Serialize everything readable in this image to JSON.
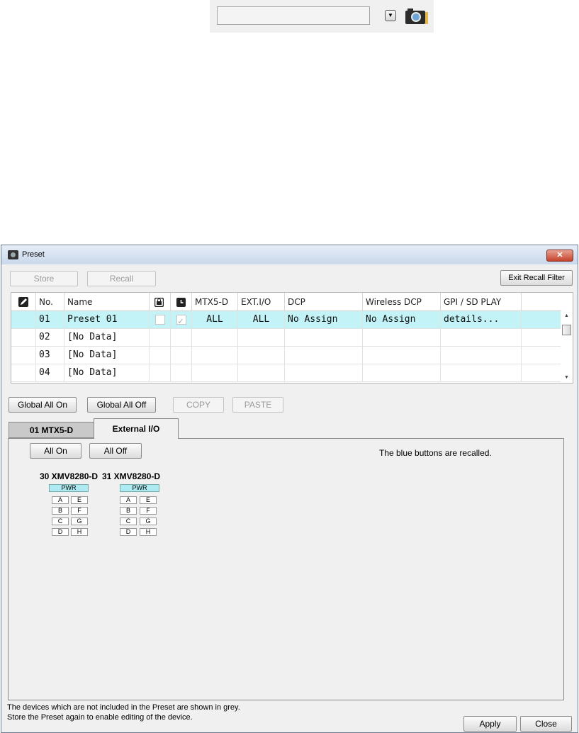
{
  "top_toolbar": {
    "dropdown_icon": "chevron-down-icon",
    "camera_icon": "camera-icon"
  },
  "window": {
    "title": "Preset",
    "close_glyph": "✕"
  },
  "toolbar": {
    "store": "Store",
    "recall": "Recall",
    "exit_recall_filter": "Exit Recall Filter"
  },
  "table": {
    "headers": {
      "edit_icon": "edit-icon",
      "no": "No.",
      "name": "Name",
      "protect_icon": "lock-icon",
      "scheduler_icon": "clock-icon",
      "mtx5d": "MTX5-D",
      "extio": "EXT.I/O",
      "dcp": "DCP",
      "wireless_dcp": "Wireless DCP",
      "gpi": "GPI / SD PLAY"
    },
    "rows": [
      {
        "no": "01",
        "name": "Preset 01",
        "protect": false,
        "scheduler": true,
        "mtx5d": "ALL",
        "extio": "ALL",
        "dcp": "No Assign",
        "wireless_dcp": "No Assign",
        "gpi": "details..."
      },
      {
        "no": "02",
        "name": "[No Data]",
        "mtx5d": "",
        "extio": "",
        "dcp": "",
        "wireless_dcp": "",
        "gpi": ""
      },
      {
        "no": "03",
        "name": "[No Data]",
        "mtx5d": "",
        "extio": "",
        "dcp": "",
        "wireless_dcp": "",
        "gpi": ""
      },
      {
        "no": "04",
        "name": "[No Data]",
        "mtx5d": "",
        "extio": "",
        "dcp": "",
        "wireless_dcp": "",
        "gpi": ""
      }
    ]
  },
  "actions": {
    "global_all_on": "Global All On",
    "global_all_off": "Global All Off",
    "copy": "COPY",
    "paste": "PASTE"
  },
  "tabs": [
    {
      "label": "01 MTX5-D",
      "active": false
    },
    {
      "label": "External I/O",
      "active": true
    }
  ],
  "panel": {
    "all_on": "All On",
    "all_off": "All Off",
    "note": "The blue buttons are recalled.",
    "devices": [
      {
        "name": "30 XMV8280-D",
        "pwr": "PWR",
        "channels": [
          "A",
          "E",
          "B",
          "F",
          "C",
          "G",
          "D",
          "H"
        ]
      },
      {
        "name": "31 XMV8280-D",
        "pwr": "PWR",
        "channels": [
          "A",
          "E",
          "B",
          "F",
          "C",
          "G",
          "D",
          "H"
        ]
      }
    ]
  },
  "footer": {
    "line1": "The devices which are not included in the Preset are shown in grey.",
    "line2": "Store the Preset again to enable editing of the device.",
    "apply": "Apply",
    "close": "Close"
  }
}
